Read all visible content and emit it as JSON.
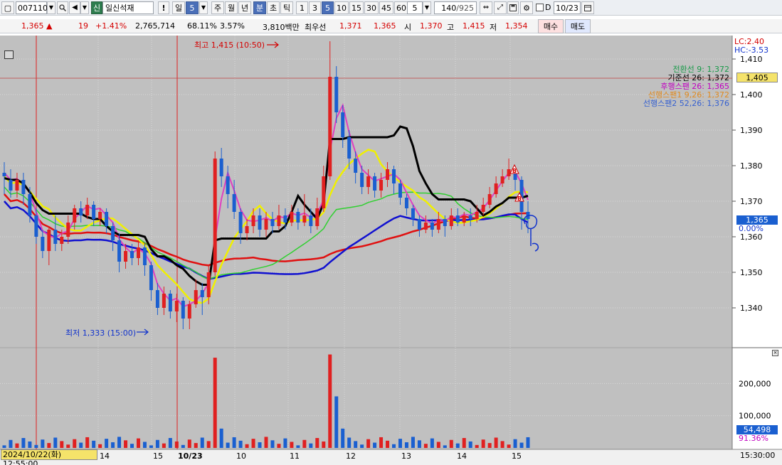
{
  "toolbar": {
    "code": "007110",
    "shin_badge": "신",
    "name": "일신석재",
    "period_day": "일",
    "period_num": "5",
    "btn_week": "주",
    "btn_month": "월",
    "btn_year": "년",
    "btn_min": "분",
    "btn_sec": "초",
    "btn_tick": "틱",
    "intervals": [
      "1",
      "3",
      "5",
      "10",
      "15",
      "30",
      "45",
      "60"
    ],
    "selected_interval": "5",
    "count_value": "5",
    "view_count": "140",
    "total_count": "/925",
    "d_label": "D",
    "date_value": "10/23"
  },
  "quote": {
    "price": "1,365",
    "arrow": "▲",
    "change": "19",
    "change_pct": "+1.41%",
    "volume": "2,765,714",
    "vol_ratio": "68.11%",
    "turnover": "3.57%",
    "amount": "3,810백만",
    "best_label": "최우선",
    "best_ask": "1,371",
    "best_bid": "1,365",
    "open_label": "시",
    "open": "1,370",
    "high_label": "고",
    "high": "1,415",
    "low_label": "저",
    "low": "1,354",
    "buy_label": "매수",
    "sell_label": "매도"
  },
  "legend": {
    "lc": "LC:2.40",
    "hc": "HC:-3.53",
    "conv": "전환선 9: 1,372",
    "base": "기준선 26: 1,372",
    "lag": "후행스팬 26: 1,365",
    "span1": "선행스팬1 9,26: 1,372",
    "span2": "선행스팬2 52,26: 1,376"
  },
  "annotations": {
    "high_mark": "최고 1,415 (10:50)",
    "low_mark": "최저 1,333 (15:00)",
    "crosshair_price": "1,405",
    "current_price": "1,365",
    "current_pct": "0.00%",
    "vol_value": "54,498",
    "vol_pct": "91.36%",
    "datetime": "2024/10/22(화) 12:55:00",
    "time_right": "15:30:00",
    "date_mark": "10/23",
    "b_marker": "B"
  },
  "axis": {
    "price_ticks": [
      "1,410",
      "1,400",
      "1,390",
      "1,380",
      "1,370",
      "1,360",
      "1,350",
      "1,340"
    ],
    "volume_ticks": [
      "200,000",
      "100,000"
    ],
    "time_ticks": [
      "14",
      "15",
      "10",
      "11",
      "12",
      "13",
      "14",
      "15"
    ]
  },
  "colors": {
    "chart_bg": "#c0c0c0",
    "up": "#e02020",
    "down": "#1a5fd0",
    "base_line": "#000000",
    "conv_line": "#e040c0",
    "yellow_line": "#f0f000",
    "green_line": "#30d030",
    "blue_line": "#1010d0",
    "red_line": "#e01010"
  }
}
